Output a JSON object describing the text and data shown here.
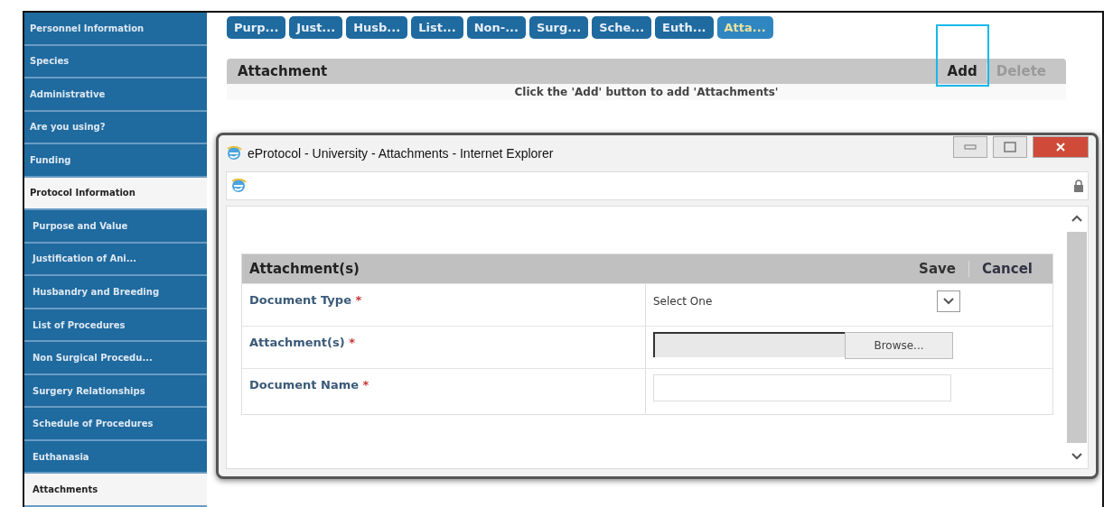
{
  "sidebar": {
    "items": [
      {
        "label": "Personnel Information",
        "kind": "section",
        "selected": false
      },
      {
        "label": "Species",
        "kind": "section",
        "selected": false
      },
      {
        "label": "Administrative",
        "kind": "section",
        "selected": false
      },
      {
        "label": "Are you using?",
        "kind": "section",
        "selected": false
      },
      {
        "label": "Funding",
        "kind": "section",
        "selected": false
      },
      {
        "label": "Protocol Information",
        "kind": "section",
        "selected": true
      },
      {
        "label": "Purpose and Value",
        "kind": "sub",
        "selected": false
      },
      {
        "label": "Justification of Ani...",
        "kind": "sub",
        "selected": false
      },
      {
        "label": "Husbandry and Breeding",
        "kind": "sub",
        "selected": false
      },
      {
        "label": "List of Procedures",
        "kind": "sub",
        "selected": false
      },
      {
        "label": "Non Surgical Procedu...",
        "kind": "sub",
        "selected": false
      },
      {
        "label": "Surgery Relationships",
        "kind": "sub",
        "selected": false
      },
      {
        "label": "Schedule of Procedures",
        "kind": "sub",
        "selected": false
      },
      {
        "label": "Euthanasia",
        "kind": "sub",
        "selected": false
      },
      {
        "label": "Attachments",
        "kind": "sub",
        "selected": true
      }
    ]
  },
  "tabs": [
    {
      "label": "Purp...",
      "selected": false
    },
    {
      "label": "Just...",
      "selected": false
    },
    {
      "label": "Husb...",
      "selected": false
    },
    {
      "label": "List...",
      "selected": false
    },
    {
      "label": "Non-...",
      "selected": false
    },
    {
      "label": "Surg...",
      "selected": false
    },
    {
      "label": "Sche...",
      "selected": false
    },
    {
      "label": "Euth...",
      "selected": false
    },
    {
      "label": "Atta...",
      "selected": true
    }
  ],
  "section": {
    "title": "Attachment",
    "actions": [
      {
        "label": "Add",
        "disabled": false,
        "highlighted": true
      },
      {
        "label": "Delete",
        "disabled": true,
        "highlighted": false
      }
    ],
    "message": "Click the 'Add' button to add 'Attachments'"
  },
  "popup": {
    "title": "eProtocol - University - Attachments - Internet Explorer",
    "form": {
      "title": "Attachment(s)",
      "actions": [
        "Save",
        "Cancel"
      ],
      "fields": [
        {
          "label": "Document Type",
          "required_mark": "*",
          "kind": "select",
          "value": "Select One"
        },
        {
          "label": "Attachment(s)",
          "required_mark": "*",
          "kind": "file",
          "button": "Browse..."
        },
        {
          "label": "Document Name",
          "required_mark": "*",
          "kind": "text"
        }
      ]
    }
  }
}
